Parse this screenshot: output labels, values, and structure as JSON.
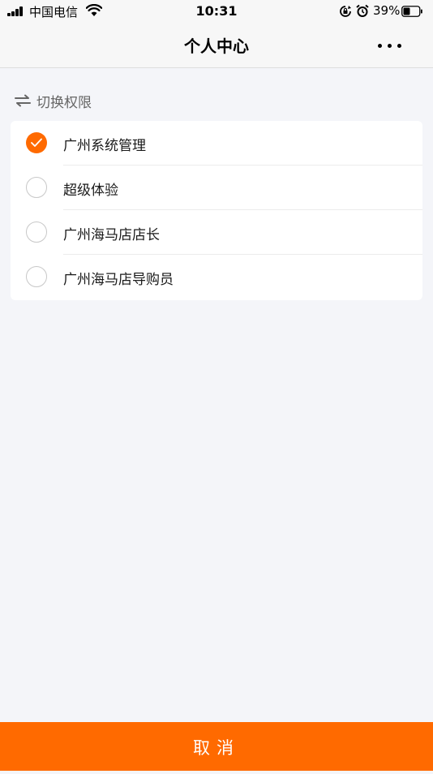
{
  "status_bar": {
    "carrier": "中国电信",
    "time": "10:31",
    "battery_percent": "39%"
  },
  "nav": {
    "title": "个人中心",
    "more_icon": "more-dots-icon"
  },
  "section": {
    "icon": "swap-arrows-icon",
    "title": "切换权限"
  },
  "roles": [
    {
      "label": "广州系统管理",
      "selected": true
    },
    {
      "label": "超级体验",
      "selected": false
    },
    {
      "label": "广州海马店店长",
      "selected": false
    },
    {
      "label": "广州海马店导购员",
      "selected": false
    }
  ],
  "cancel_label": "取消",
  "colors": {
    "accent": "#ff6a00",
    "background": "#f4f5f9"
  }
}
